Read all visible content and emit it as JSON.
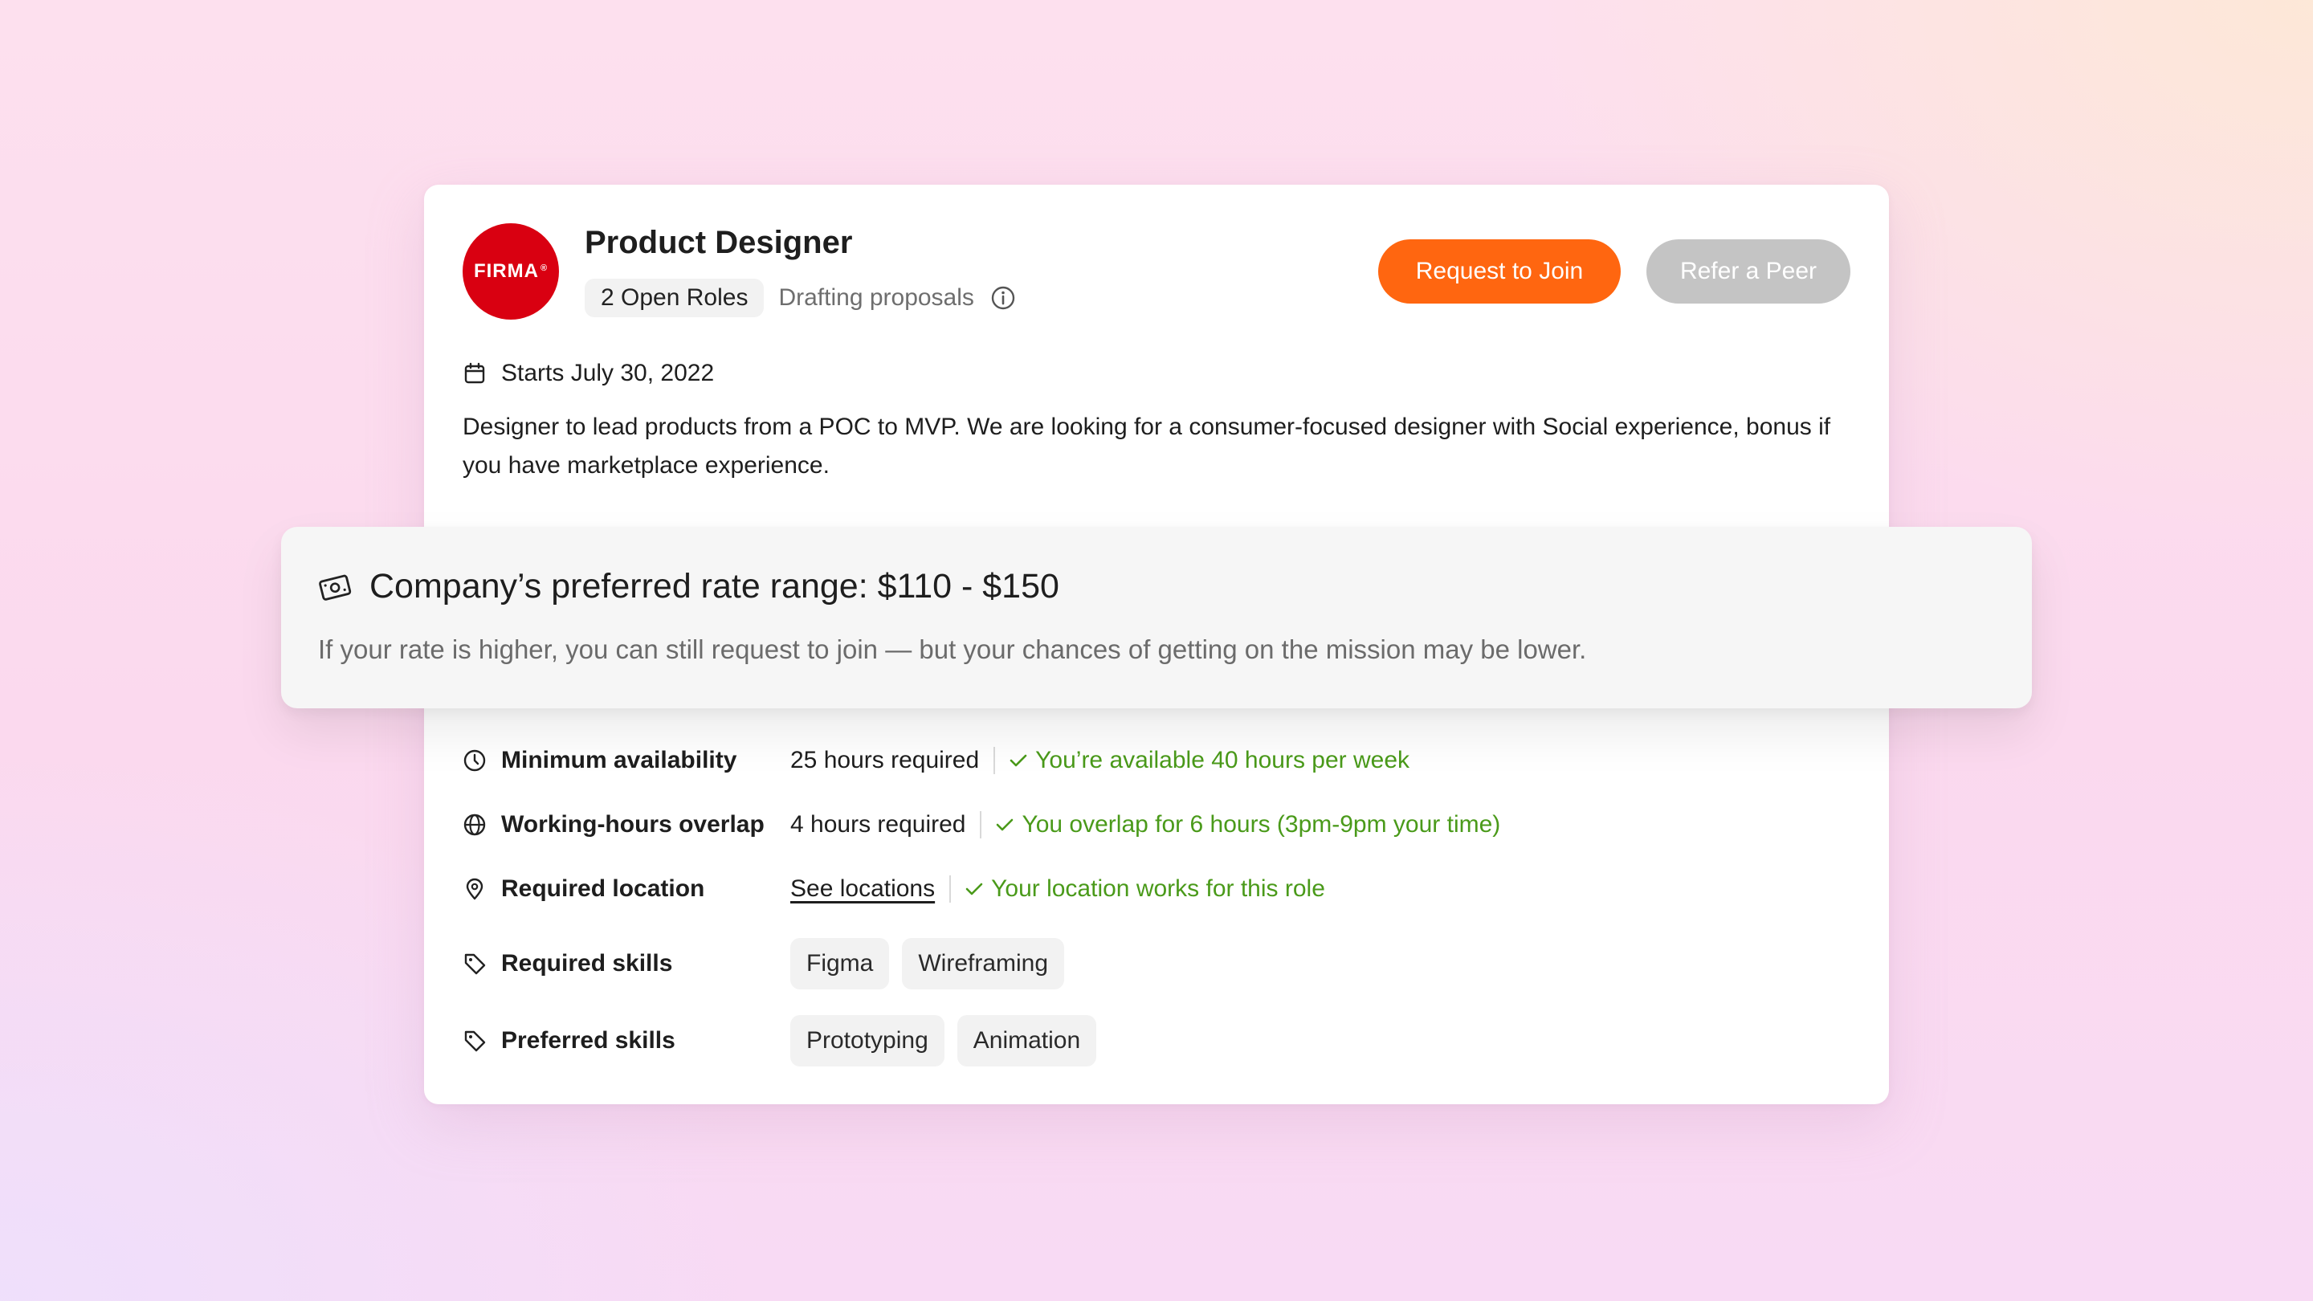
{
  "job": {
    "company_logo_text": "FIRMA",
    "company_logo_mark": "®",
    "title": "Product Designer",
    "open_roles": "2 Open Roles",
    "status": "Drafting proposals",
    "start_date": "Starts July 30, 2022",
    "description": "Designer to lead products from a POC to MVP. We are looking for a consumer-focused designer with Social experience, bonus if you have marketplace experience."
  },
  "actions": {
    "request_label": "Request to Join",
    "refer_label": "Refer a Peer"
  },
  "rate": {
    "title": "Company’s preferred rate range: $110 - $150",
    "note": "If your rate is higher, you can still request to join — but your chances of getting on the mission may be lower."
  },
  "requirements": {
    "availability": {
      "label": "Minimum availability",
      "value": "25 hours required",
      "status": "You’re available 40 hours per week"
    },
    "overlap": {
      "label": "Working-hours overlap",
      "value": "4 hours required",
      "status": "You overlap for 6 hours (3pm-9pm your time)"
    },
    "location": {
      "label": "Required location",
      "link": "See locations",
      "status": "Your location works for this role"
    },
    "required_skills": {
      "label": "Required skills",
      "tags": [
        "Figma",
        "Wireframing"
      ]
    },
    "preferred_skills": {
      "label": "Preferred skills",
      "tags": [
        "Prototyping",
        "Animation"
      ]
    }
  },
  "colors": {
    "accent": "#ff6610",
    "logo": "#d90011",
    "success": "#4a9a1a",
    "disabled": "#c4c4c4"
  },
  "icons": [
    "info-icon",
    "calendar-icon",
    "money-icon",
    "clock-icon",
    "globe-icon",
    "location-pin-icon",
    "tag-icon",
    "check-icon"
  ]
}
